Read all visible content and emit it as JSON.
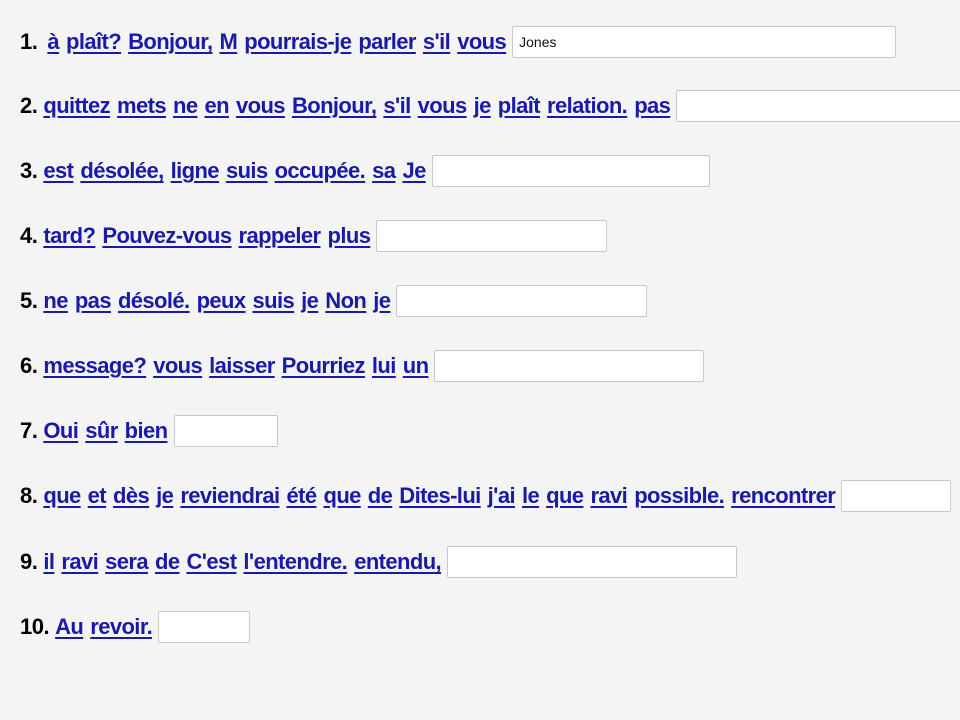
{
  "exercise": {
    "rows": [
      {
        "number": "1.",
        "words": [
          "à",
          "plaît?",
          "Bonjour,",
          "M",
          "pourrais-je",
          "parler",
          "s'il",
          "vous"
        ],
        "answer": "Jones"
      },
      {
        "number": "2.",
        "words": [
          "quittez",
          "mets",
          "ne",
          "en",
          "vous",
          "Bonjour,",
          "s'il",
          "vous",
          "je",
          "plaît",
          "relation.",
          "pas"
        ],
        "answer": ""
      },
      {
        "number": "3.",
        "words": [
          "est",
          "désolée,",
          "ligne",
          "suis",
          "occupée.",
          "sa",
          "Je"
        ],
        "answer": ""
      },
      {
        "number": "4.",
        "words": [
          "tard?",
          "Pouvez-vous",
          "rappeler",
          "plus"
        ],
        "answer": ""
      },
      {
        "number": "5.",
        "words": [
          "ne",
          "pas",
          "désolé.",
          "peux",
          "suis",
          "je",
          "Non",
          "je"
        ],
        "answer": ""
      },
      {
        "number": "6.",
        "words": [
          "message?",
          "vous",
          "laisser",
          "Pourriez",
          "lui",
          "un"
        ],
        "answer": ""
      },
      {
        "number": "7.",
        "words": [
          "Oui",
          "sûr",
          "bien"
        ],
        "answer": ""
      },
      {
        "number": "8.",
        "words": [
          "que",
          "et",
          "dès",
          "je",
          "reviendrai",
          "été",
          "que",
          "de",
          "Dites-lui",
          "j'ai",
          "le",
          "que",
          "ravi",
          "possible.",
          "rencontrer"
        ],
        "answer": ""
      },
      {
        "number": "9.",
        "words": [
          "il",
          "ravi",
          "sera",
          "de",
          "C'est",
          "l'entendre.",
          "entendu,"
        ],
        "answer": ""
      },
      {
        "number": "10.",
        "words": [
          "Au",
          "revoir."
        ],
        "answer": ""
      }
    ]
  }
}
